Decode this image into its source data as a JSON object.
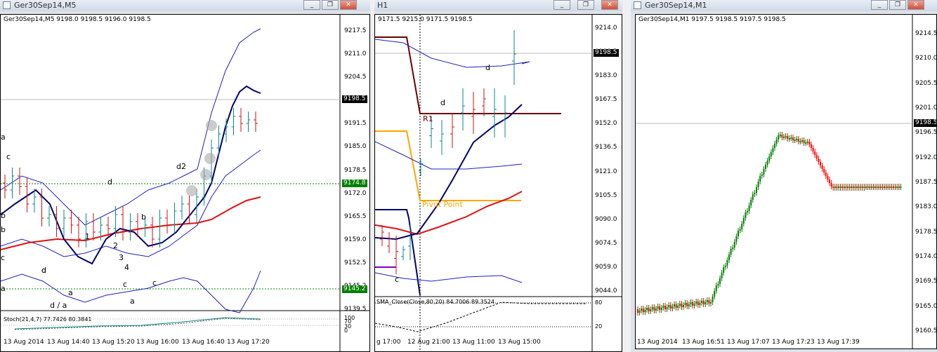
{
  "windows": [
    {
      "title": "Ger30Sep14,M5",
      "info": "Ger30Sep14,M5  9198.0 9198.5 9196.0 9198.5",
      "price_ticks": [
        "9217.5",
        "9211.0",
        "9204.5",
        "9198.0",
        "9191.5",
        "9185.0",
        "9178.5",
        "9172.0",
        "9165.5",
        "9159.0",
        "9152.5",
        "9145.2",
        "9139.5"
      ],
      "current_price": "9198.5",
      "level_price": "9174.8",
      "lower_price": "9145.2",
      "time_labels": [
        "13 Aug 2014",
        "13 Aug 14:40",
        "13 Aug 15:20",
        "13 Aug 16:00",
        "13 Aug 16:40",
        "13 Aug 17:20"
      ],
      "annotations": [
        "a",
        "c",
        "b",
        "d",
        "1",
        "2",
        "3",
        "4",
        "c",
        "a",
        "b",
        "d",
        "c",
        "d / a",
        "a",
        "c",
        "d2",
        "b",
        "d",
        "a"
      ],
      "indicator": "Stoch(21,4,7) 77.7426 80.3841",
      "indicator_levels": [
        "100",
        "70",
        "30",
        "0"
      ]
    },
    {
      "title": "H1",
      "info": "9171.5 9215.0 9171.5 9198.5",
      "price_ticks": [
        "9214.0",
        "9198.5",
        "9183.0",
        "9167.5",
        "9152.0",
        "9136.5",
        "9121.0",
        "9105.5",
        "9090.0",
        "9074.5",
        "9059.0",
        "9044.0"
      ],
      "current_price": "9198.5",
      "time_labels": [
        "g 17:00",
        "12 Aug 21:00",
        "13 Aug 11:00",
        "13 Aug 15:00"
      ],
      "annotations": [
        "R1",
        "Pivot Point",
        "d",
        "d",
        "c"
      ],
      "indicator": "SMA_Close(Close,80,20) 84.7006 89.3524",
      "indicator_levels": [
        "80",
        "20"
      ]
    },
    {
      "title": "Ger30Sep14,M1",
      "info": "Ger30Sep14,M1  9197.5 9198.5 9197.5 9198.5",
      "price_ticks": [
        "9214.5",
        "9210.0",
        "9205.5",
        "9201.0",
        "9196.5",
        "9192.0",
        "9187.5",
        "9183.0",
        "9178.5",
        "9174.0",
        "9169.5",
        "9165.0",
        "9160.5"
      ],
      "current_price": "9198.5",
      "time_labels": [
        "13 Aug 2014",
        "13 Aug 16:51",
        "13 Aug 17:07",
        "13 Aug 17:23",
        "13 Aug 17:39"
      ]
    }
  ],
  "colors": {
    "bull": "#008000",
    "bear": "#ff0000",
    "teal": "#0a8a8a",
    "navy": "#00006e",
    "ma_red": "#e01010",
    "band": "#2020c0",
    "pivot": "#ffa500",
    "r1": "#6b0000",
    "level_green": "#008000"
  },
  "icons": [
    "window-chart-icon",
    "minimize-icon",
    "restore-icon",
    "close-icon"
  ]
}
